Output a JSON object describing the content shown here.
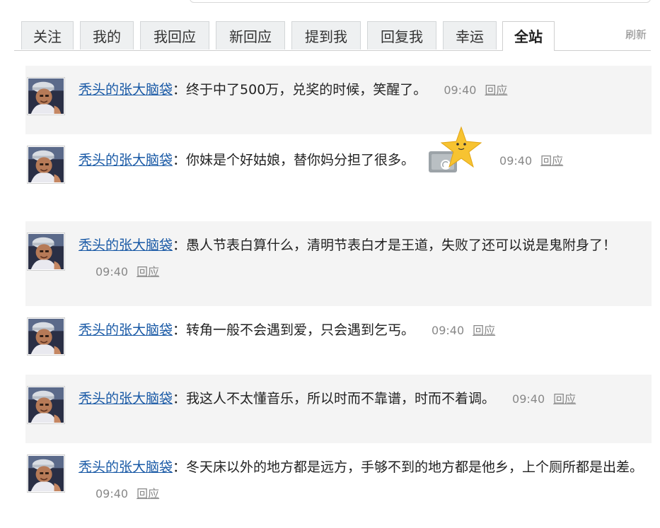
{
  "tabs": [
    "关注",
    "我的",
    "我回应",
    "新回应",
    "提到我",
    "回复我",
    "幸运",
    "全站"
  ],
  "active_tab": "全站",
  "refresh_label": "刷新",
  "posts": [
    {
      "author": "秃头的张大脑袋",
      "text": "终于中了500万，兑奖的时候，笑醒了。",
      "time": "09:40",
      "reply": "回应"
    },
    {
      "author": "秃头的张大脑袋",
      "text": "你妹是个好姑娘，替你妈分担了很多。",
      "time": "09:40",
      "reply": "回应",
      "icon": "star-sticker-icon"
    },
    {
      "author": "秃头的张大脑袋",
      "text": "愚人节表白算什么，清明节表白才是王道，失败了还可以说是鬼附身了！",
      "time": "09:40",
      "reply": "回应"
    },
    {
      "author": "秃头的张大脑袋",
      "text": "转角一般不会遇到爱，只会遇到乞丐。",
      "time": "09:40",
      "reply": "回应"
    },
    {
      "author": "秃头的张大脑袋",
      "text": "我这人不太懂音乐，所以时而不靠谱，时而不着调。",
      "time": "09:40",
      "reply": "回应"
    },
    {
      "author": "秃头的张大脑袋",
      "text": "冬天床以外的地方都是远方，手够不到的地方都是他乡，上个厕所都是出差。",
      "time": "09:40",
      "reply": "回应"
    }
  ],
  "colors": {
    "link": "#1a5aa6",
    "meta": "#888888",
    "row_shade": "#f4f4f4",
    "tab_bg": "#eef0f1"
  }
}
